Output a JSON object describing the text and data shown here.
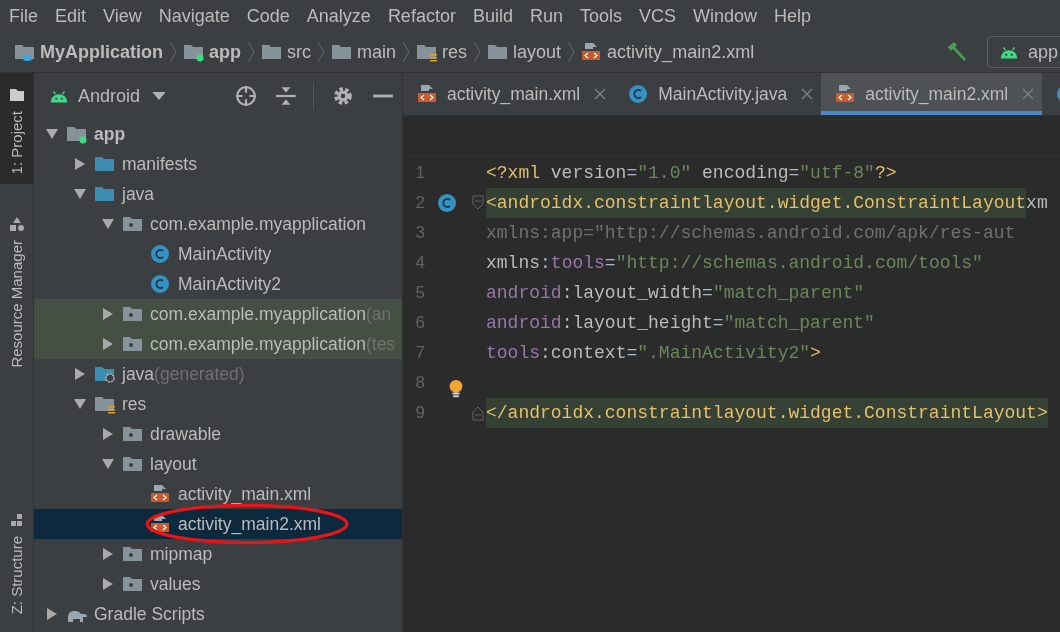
{
  "menu": [
    {
      "label": "File"
    },
    {
      "label": "Edit"
    },
    {
      "label": "View"
    },
    {
      "label": "Navigate"
    },
    {
      "label": "Code"
    },
    {
      "label": "Analyze"
    },
    {
      "label": "Refactor"
    },
    {
      "label": "Build"
    },
    {
      "label": "Run"
    },
    {
      "label": "Tools"
    },
    {
      "label": "VCS"
    },
    {
      "label": "Window"
    },
    {
      "label": "Help"
    }
  ],
  "breadcrumb": [
    {
      "label": "MyApplication",
      "kind": "project",
      "bold": true
    },
    {
      "label": "app",
      "kind": "module",
      "bold": true
    },
    {
      "label": "src",
      "kind": "folder",
      "bold": false
    },
    {
      "label": "main",
      "kind": "folder",
      "bold": false
    },
    {
      "label": "res",
      "kind": "res",
      "bold": false
    },
    {
      "label": "layout",
      "kind": "folder",
      "bold": false
    },
    {
      "label": "activity_main2.xml",
      "kind": "xml",
      "bold": false
    }
  ],
  "run_config": {
    "label": "app"
  },
  "tool_strip": [
    {
      "label": "1: Project",
      "selected": true,
      "kind": "folder"
    },
    {
      "label": "Resource Manager",
      "selected": false,
      "kind": "shapes"
    },
    {
      "label": "Z: Structure",
      "selected": false,
      "kind": "structure"
    }
  ],
  "project_panel": {
    "view": "Android",
    "tree": [
      {
        "label": "app",
        "kind": "module",
        "bold": true,
        "expanded": true,
        "selected": false,
        "highlighted": false,
        "children": [
          {
            "label": "manifests",
            "kind": "source",
            "expanded": false,
            "selected": false,
            "highlighted": false
          },
          {
            "label": "java",
            "kind": "source",
            "expanded": true,
            "selected": false,
            "highlighted": false,
            "children": [
              {
                "label": "com.example.myapplication",
                "kind": "package",
                "expanded": true,
                "selected": false,
                "highlighted": false,
                "children": [
                  {
                    "label": "MainActivity",
                    "kind": "class",
                    "selected": false,
                    "highlighted": false
                  },
                  {
                    "label": "MainActivity2",
                    "kind": "class",
                    "selected": false,
                    "highlighted": false
                  }
                ]
              },
              {
                "label": "com.example.myapplication",
                "suffix": "(an",
                "kind": "package",
                "expanded": false,
                "selected": false,
                "highlighted": true
              },
              {
                "label": "com.example.myapplication",
                "suffix": "(tes",
                "kind": "package",
                "expanded": false,
                "selected": false,
                "highlighted": true
              }
            ]
          },
          {
            "label": "java",
            "suffix": "(generated)",
            "kind": "generated",
            "expanded": false,
            "selected": false,
            "highlighted": false
          },
          {
            "label": "res",
            "kind": "res",
            "expanded": true,
            "selected": false,
            "highlighted": false,
            "children": [
              {
                "label": "drawable",
                "kind": "package",
                "expanded": false,
                "selected": false,
                "highlighted": false
              },
              {
                "label": "layout",
                "kind": "package",
                "expanded": true,
                "selected": false,
                "highlighted": false,
                "children": [
                  {
                    "label": "activity_main.xml",
                    "kind": "xml",
                    "selected": false,
                    "highlighted": false,
                    "circled": false
                  },
                  {
                    "label": "activity_main2.xml",
                    "kind": "xml",
                    "selected": true,
                    "highlighted": false,
                    "circled": true
                  }
                ]
              },
              {
                "label": "mipmap",
                "kind": "package",
                "expanded": false,
                "selected": false,
                "highlighted": false
              },
              {
                "label": "values",
                "kind": "package",
                "expanded": false,
                "selected": false,
                "highlighted": false
              }
            ]
          }
        ]
      },
      {
        "label": "Gradle Scripts",
        "kind": "gradle",
        "expanded": false,
        "selected": false,
        "highlighted": false
      }
    ]
  },
  "editor_tabs": [
    {
      "label": "activity_main.xml",
      "kind": "xml",
      "selected": false
    },
    {
      "label": "MainActivity.java",
      "kind": "class",
      "selected": false
    },
    {
      "label": "activity_main2.xml",
      "kind": "xml",
      "selected": true
    },
    {
      "kind": "class",
      "selected": false
    }
  ],
  "code_lines": [
    {
      "number": "1",
      "highlighted": false,
      "tokens": [
        {
          "text": "<?xml ",
          "kind": "tag"
        },
        {
          "text": "version",
          "kind": "attr"
        },
        {
          "text": "=",
          "kind": "plain"
        },
        {
          "text": "\"1.0\"",
          "kind": "str"
        },
        {
          "text": " encoding",
          "kind": "attr"
        },
        {
          "text": "=",
          "kind": "plain"
        },
        {
          "text": "\"utf-8\"",
          "kind": "str"
        },
        {
          "text": "?>",
          "kind": "tag"
        }
      ]
    },
    {
      "number": "2",
      "highlighted": true,
      "gutter": {
        "kind": "class"
      },
      "fold": {
        "kind": "start"
      },
      "tokens": [
        {
          "text": "<androidx.constraintlayout.widget.ConstraintLayout",
          "kind": "tag"
        }
      ],
      "after": [
        {
          "text": " xm",
          "kind": "attr"
        }
      ]
    },
    {
      "number": "3",
      "highlighted": false,
      "tokens": [
        {
          "text": "    xmlns:app=\"http://schemas.android.com/apk/res-aut",
          "kind": "dim"
        }
      ]
    },
    {
      "number": "4",
      "highlighted": false,
      "tokens": [
        {
          "text": "    xmlns",
          "kind": "attr"
        },
        {
          "text": ":",
          "kind": "plain"
        },
        {
          "text": "tools",
          "kind": "ns"
        },
        {
          "text": "=",
          "kind": "plain"
        },
        {
          "text": "\"http://schemas.android.com/tools\"",
          "kind": "str"
        }
      ]
    },
    {
      "number": "5",
      "highlighted": false,
      "tokens": [
        {
          "text": "    android",
          "kind": "ns"
        },
        {
          "text": ":layout_width",
          "kind": "attr"
        },
        {
          "text": "=",
          "kind": "plain"
        },
        {
          "text": "\"match_parent\"",
          "kind": "str"
        }
      ]
    },
    {
      "number": "6",
      "highlighted": false,
      "tokens": [
        {
          "text": "    android",
          "kind": "ns"
        },
        {
          "text": ":layout_height",
          "kind": "attr"
        },
        {
          "text": "=",
          "kind": "plain"
        },
        {
          "text": "\"match_parent\"",
          "kind": "str"
        }
      ]
    },
    {
      "number": "7",
      "highlighted": false,
      "tokens": [
        {
          "text": "    tools",
          "kind": "ns"
        },
        {
          "text": ":context",
          "kind": "attr"
        },
        {
          "text": "=",
          "kind": "plain"
        },
        {
          "text": "\".MainActivity2\"",
          "kind": "str"
        },
        {
          "text": ">",
          "kind": "tag"
        }
      ]
    },
    {
      "number": "8",
      "highlighted": false,
      "gutter": {
        "kind": "bulb"
      }
    },
    {
      "number": "9",
      "highlighted": true,
      "fold": {
        "kind": "end"
      },
      "tokens": [
        {
          "text": "</androidx.constraintlayout.widget.ConstraintLayout>",
          "kind": "tag"
        }
      ]
    }
  ]
}
